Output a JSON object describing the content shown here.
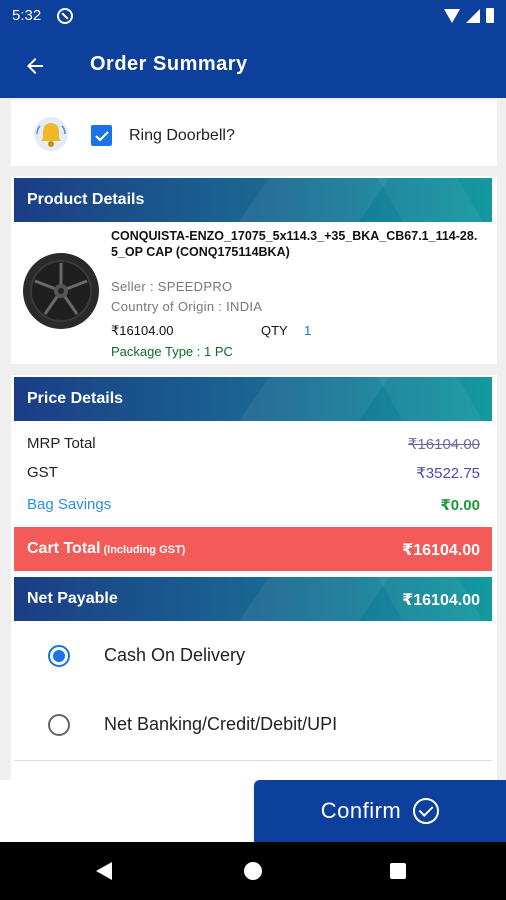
{
  "status_bar": {
    "time": "5:32"
  },
  "app_bar": {
    "title": "Order Summary"
  },
  "doorbell": {
    "label": "Ring Doorbell?",
    "checked": true
  },
  "product_section": {
    "title": "Product Details",
    "name": "CONQUISTA-ENZO_17075_5x114.3_+35_BKA_CB67.1_114-28.5_OP CAP (CONQ175114BKA)",
    "seller": "Seller : SPEEDPRO",
    "origin": "Country of Origin : INDIA",
    "price": "₹16104.00",
    "qty_label": "QTY",
    "qty_value": "1",
    "package": "Package Type : 1 PC"
  },
  "price_section": {
    "title": "Price Details",
    "mrp_label": "MRP Total",
    "mrp_value": "₹16104.00",
    "gst_label": "GST",
    "gst_value": "₹3522.75",
    "savings_label": "Bag Savings",
    "savings_value": "₹0.00",
    "cart_total_label": "Cart Total",
    "cart_total_note": "(Including GST)",
    "cart_total_value": "₹16104.00",
    "net_payable_label": "Net Payable",
    "net_payable_value": "₹16104.00"
  },
  "payment_options": [
    {
      "label": "Cash On Delivery",
      "selected": true
    },
    {
      "label": "Net Banking/Credit/Debit/UPI",
      "selected": false
    }
  ],
  "confirm": {
    "label": "Confirm"
  },
  "colors": {
    "primary": "#0d3f9c",
    "accent_blue": "#1a73e8",
    "cart_total_red": "#f35b58",
    "savings_green": "#1f9a3a"
  }
}
